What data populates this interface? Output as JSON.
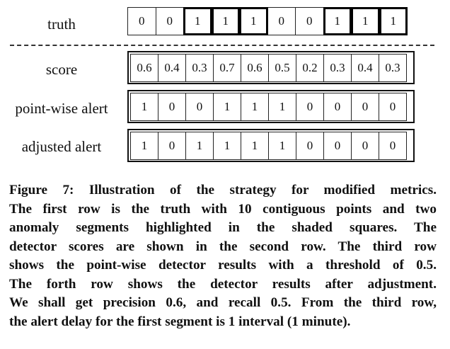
{
  "rows": [
    {
      "label": "truth",
      "values": [
        "0",
        "0",
        "1",
        "1",
        "1",
        "0",
        "0",
        "1",
        "1",
        "1"
      ],
      "highlight": [
        false,
        false,
        true,
        true,
        true,
        false,
        false,
        true,
        true,
        true
      ]
    },
    {
      "label": "score",
      "values": [
        "0.6",
        "0.4",
        "0.3",
        "0.7",
        "0.6",
        "0.5",
        "0.2",
        "0.3",
        "0.4",
        "0.3"
      ]
    },
    {
      "label": "point-wise alert",
      "values": [
        "1",
        "0",
        "0",
        "1",
        "1",
        "1",
        "0",
        "0",
        "0",
        "0"
      ]
    },
    {
      "label": "adjusted alert",
      "values": [
        "1",
        "0",
        "1",
        "1",
        "1",
        "1",
        "0",
        "0",
        "0",
        "0"
      ]
    }
  ],
  "caption_lines": [
    "Figure 7: Illustration of the strategy for modified metrics.",
    "The first row is the truth with 10 contiguous points and two",
    "anomaly segments highlighted in the shaded squares. The",
    "detector scores are shown in the second row. The third row",
    "shows the point-wise detector results with a threshold of 0.5.",
    "The forth row shows the detector results after adjustment.",
    "We shall get precision 0.6, and recall 0.5. From the third row,",
    "the alert delay for the first segment is 1 interval (1 minute)."
  ]
}
